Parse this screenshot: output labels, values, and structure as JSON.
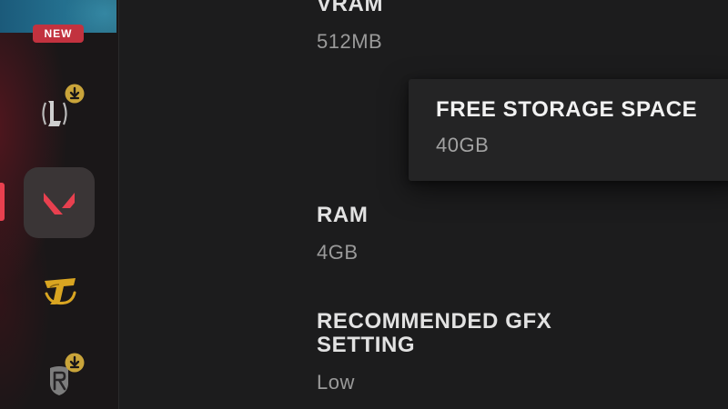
{
  "sidebar": {
    "banner_badge": "NEW",
    "items": [
      {
        "name": "League of Legends",
        "icon": "league-of-legends-icon",
        "has_download": true,
        "active": false
      },
      {
        "name": "VALORANT",
        "icon": "valorant-icon",
        "has_download": false,
        "active": true
      },
      {
        "name": "Teamfight Tactics",
        "icon": "teamfight-tactics-icon",
        "has_download": false,
        "active": false
      },
      {
        "name": "Legends of Runeterra",
        "icon": "legends-of-runeterra-icon",
        "has_download": true,
        "active": false
      }
    ]
  },
  "specs": [
    {
      "label": "VRAM",
      "value": "512MB"
    },
    {
      "label": "FREE STORAGE SPACE",
      "value": "40GB",
      "highlighted": true
    },
    {
      "label": "RAM",
      "value": "4GB"
    },
    {
      "label": "RECOMMENDED GFX SETTING",
      "value": "Low"
    }
  ],
  "colors": {
    "background": "#1c1c1d",
    "sidebar": "#1a1718",
    "accent_red": "#e8404f",
    "badge_red": "#c2323f",
    "download_gold": "#c9a43a",
    "tft_gold": "#d9a521"
  }
}
